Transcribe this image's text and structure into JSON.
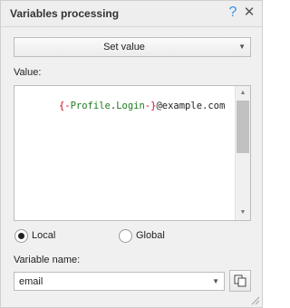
{
  "window": {
    "title": "Variables processing",
    "help_glyph": "?",
    "close_glyph": "✕"
  },
  "action_dropdown": {
    "selected": "Set value",
    "arrow_glyph": "▼"
  },
  "value_field": {
    "label": "Value:",
    "segments": [
      {
        "text": "{-",
        "color": "#d0021b"
      },
      {
        "text": "Profile",
        "color": "#1e7b1e"
      },
      {
        "text": ".",
        "color": "#222222"
      },
      {
        "text": "Login",
        "color": "#1e7b1e"
      },
      {
        "text": "-}",
        "color": "#d0021b"
      },
      {
        "text": "@example.com",
        "color": "#222222"
      }
    ],
    "scroll_up_glyph": "▲",
    "scroll_down_glyph": "▼"
  },
  "scope": {
    "options": [
      {
        "label": "Local",
        "selected": true
      },
      {
        "label": "Global",
        "selected": false
      }
    ]
  },
  "variable_name": {
    "label": "Variable name:",
    "value": "email",
    "arrow_glyph": "▼"
  },
  "icons": {
    "help": "help-icon",
    "close": "close-icon",
    "copy": "copy-icon",
    "resize": "resize-grip-icon"
  },
  "colors": {
    "accent": "#3d8ee0",
    "macro_brace": "#d0021b",
    "macro_name": "#1e7b1e"
  }
}
